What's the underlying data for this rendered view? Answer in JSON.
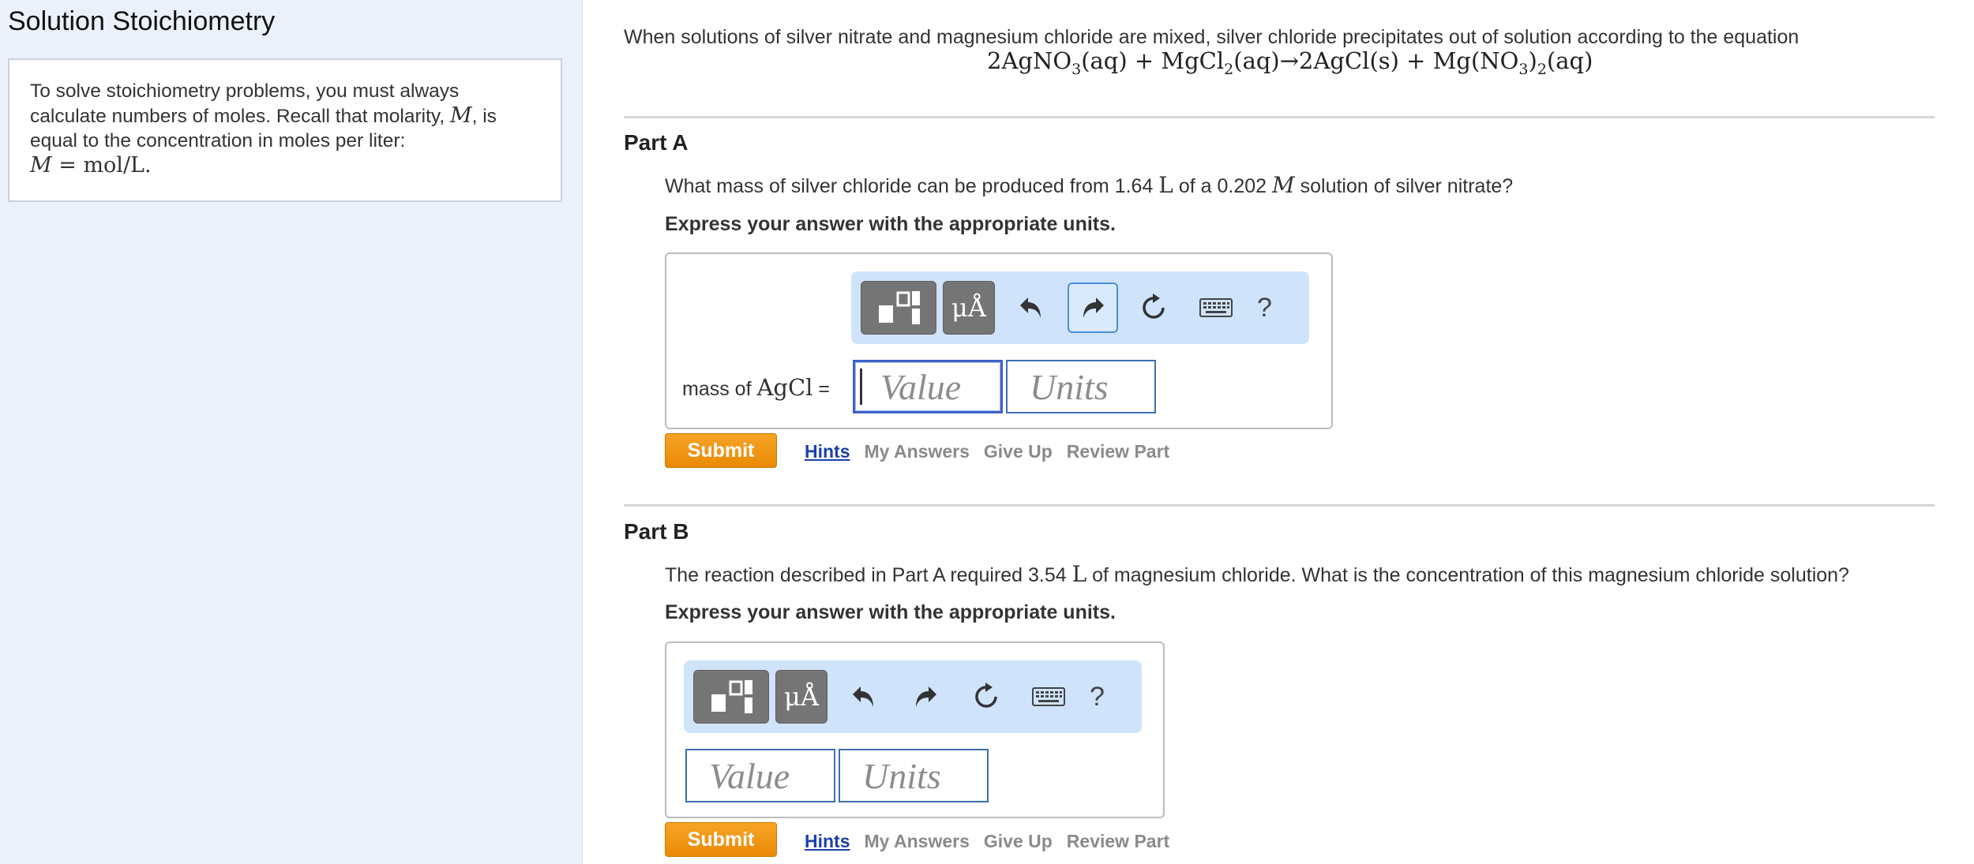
{
  "sidebar": {
    "title": "Solution Stoichiometry",
    "intro_text_1": "To solve stoichiometry problems, you must always",
    "intro_text_2": "calculate numbers of moles. Recall that molarity, ",
    "intro_text_2_var": "M",
    "intro_text_2_end": ", is",
    "intro_text_3": "equal to the concentration in moles per liter:",
    "formula_var": "M",
    "formula_rest": " = mol/L."
  },
  "problem": {
    "intro": "When solutions of silver nitrate and magnesium chloride are mixed, silver chloride precipitates out of solution according to the equation",
    "equation": {
      "t1": "2AgNO",
      "s1": "3",
      "t2": "(aq) + MgCl",
      "s2": "2",
      "t3": "(aq)→2AgCl(s) + Mg(NO",
      "s3": "3",
      "t4": ")",
      "s4": "2",
      "t5": "(aq)"
    }
  },
  "part_a": {
    "title": "Part A",
    "q1": "What mass of silver chloride can be produced from 1.64 ",
    "q_unit": "L",
    "q2": " of a 0.202 ",
    "q_var": "M",
    "q3": " solution of silver nitrate?",
    "instruction": "Express your answer with the appropriate units.",
    "label_prefix": "mass of ",
    "label_formula": "AgCl",
    "label_suffix": " =",
    "value_placeholder": "Value",
    "units_placeholder": "Units",
    "submit_label": "Submit",
    "links": {
      "hints": "Hints",
      "my_answers": "My Answers",
      "give_up": "Give Up",
      "review": "Review Part"
    }
  },
  "part_b": {
    "title": "Part B",
    "q1": "The reaction described in Part A required 3.54 ",
    "q_unit": "L",
    "q2": " of magnesium chloride. What is the concentration of this magnesium chloride solution?",
    "instruction": "Express your answer with the appropriate units.",
    "value_placeholder": "Value",
    "units_placeholder": "Units",
    "submit_label": "Submit",
    "links": {
      "hints": "Hints",
      "my_answers": "My Answers",
      "give_up": "Give Up",
      "review": "Review Part"
    }
  },
  "toolbar": {
    "icons": [
      "templates-icon",
      "symbols-icon",
      "undo-icon",
      "redo-icon",
      "reset-icon",
      "keyboard-icon",
      "help-icon"
    ],
    "symbols_label": "μÅ",
    "help_label": "?"
  },
  "colors": {
    "accent": "#ef930d",
    "link": "#1d3fa8",
    "toolbar_bg": "#cfe4fb",
    "sidebar_bg": "#eaf1fa"
  }
}
